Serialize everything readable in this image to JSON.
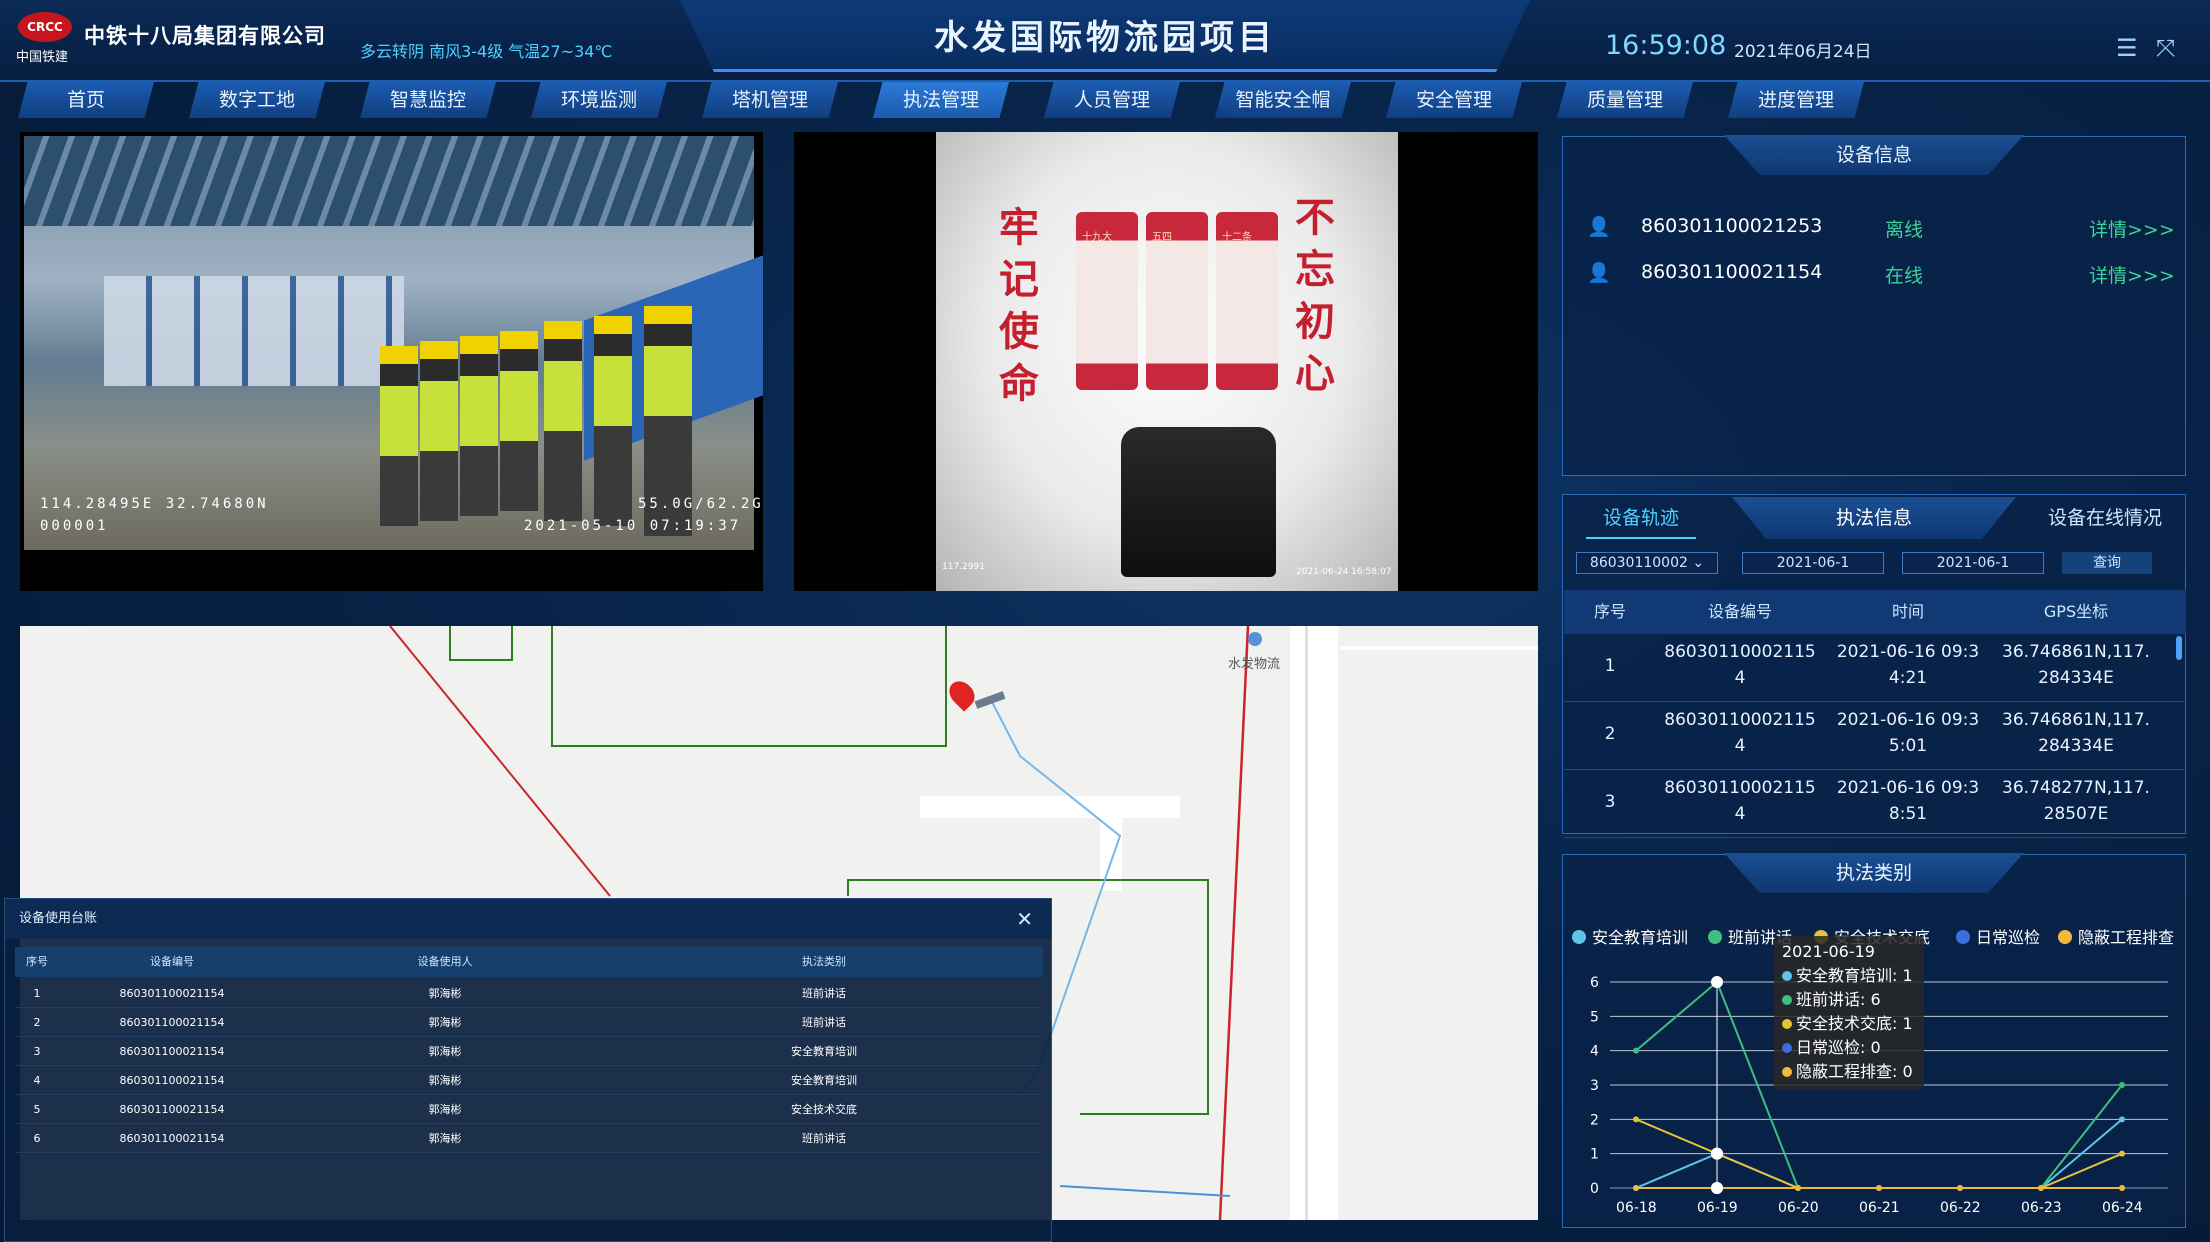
{
  "header": {
    "logo_text": "CRCC",
    "logo_sub": "中国铁建",
    "company": "中铁十八局集团有限公司",
    "weather": "多云转阴   南风3-4级   气温27~34℃",
    "title": "水发国际物流园项目",
    "time": "16:59:08",
    "date": "2021年06月24日",
    "menu_icon": "menu-list-icon",
    "fullscreen_icon": "fullscreen-icon"
  },
  "nav": [
    "首页",
    "数字工地",
    "智慧监控",
    "环境监测",
    "塔机管理",
    "执法管理",
    "人员管理",
    "智能安全帽",
    "安全管理",
    "质量管理",
    "进度管理"
  ],
  "nav_active": "执法管理",
  "video1": {
    "coords": "114.28495E 32.74680N",
    "id": "000001",
    "storage": "55.0G/62.2G",
    "timestamp": "2021-05-10  07:19:37"
  },
  "video2": {
    "slogan_left": "牢记使命",
    "slogan_right": "不忘初心",
    "panel_labels": [
      "十九大",
      "五四",
      "十二条"
    ],
    "tiny_left": "117.2991",
    "tiny_right": "2021-06-24 16:58:07"
  },
  "map": {
    "poi": "水发物流"
  },
  "device_info": {
    "title": "设备信息",
    "rows": [
      {
        "id": "860301100021253",
        "status": "离线",
        "status_color": "#3dd29a",
        "link": "详情>>>"
      },
      {
        "id": "860301100021154",
        "status": "在线",
        "status_color": "#3dd29a",
        "link": "详情>>>"
      }
    ]
  },
  "track": {
    "tabs": [
      "设备轨迹",
      "执法信息",
      "设备在线情况"
    ],
    "device_select": "86030110002",
    "date_from": "2021-06-1",
    "date_to": "2021-06-1",
    "query_label": "查询",
    "columns": [
      "序号",
      "设备编号",
      "时间",
      "GPS坐标"
    ],
    "rows": [
      {
        "no": "1",
        "dev1": "86030110002115",
        "dev2": "4",
        "t1": "2021-06-16 09:3",
        "t2": "4:21",
        "g1": "36.746861N,117.",
        "g2": "284334E"
      },
      {
        "no": "2",
        "dev1": "86030110002115",
        "dev2": "4",
        "t1": "2021-06-16 09:3",
        "t2": "5:01",
        "g1": "36.746861N,117.",
        "g2": "284334E"
      },
      {
        "no": "3",
        "dev1": "86030110002115",
        "dev2": "4",
        "t1": "2021-06-16 09:3",
        "t2": "8:51",
        "g1": "36.748277N,117.",
        "g2": "28507E"
      }
    ]
  },
  "enforcement_type": {
    "title": "执法类别",
    "tooltip": {
      "date": "2021-06-19",
      "lines": [
        "安全教育培训: 1",
        "班前讲话: 6",
        "安全技术交底: 1",
        "日常巡检: 0",
        "隐蔽工程排查: 0"
      ]
    }
  },
  "chart_data": {
    "type": "line",
    "categories": [
      "06-18",
      "06-19",
      "06-20",
      "06-21",
      "06-22",
      "06-23",
      "06-24"
    ],
    "ylim": [
      0,
      6
    ],
    "yticks": [
      "0",
      "1",
      "2",
      "3",
      "4",
      "5",
      "6"
    ],
    "legend_position": "top",
    "series": [
      {
        "name": "安全教育培训",
        "color": "#5fc3ea",
        "values": [
          0,
          1,
          0,
          0,
          0,
          0,
          2
        ]
      },
      {
        "name": "班前讲话",
        "color": "#3fbf7f",
        "values": [
          4,
          6,
          0,
          0,
          0,
          0,
          3
        ]
      },
      {
        "name": "安全技术交底",
        "color": "#e5c23a",
        "values": [
          2,
          1,
          0,
          0,
          0,
          0,
          1
        ]
      },
      {
        "name": "日常巡检",
        "color": "#3b6fe0",
        "values": [
          0,
          0,
          0,
          0,
          0,
          0,
          0
        ]
      },
      {
        "name": "隐蔽工程排查",
        "color": "#f0b93c",
        "values": [
          0,
          0,
          0,
          0,
          0,
          0,
          0
        ]
      }
    ]
  },
  "ledger": {
    "title": "设备使用台账",
    "close_icon": "close-icon",
    "columns": [
      "序号",
      "设备编号",
      "设备使用人",
      "执法类别"
    ],
    "rows": [
      {
        "no": "1",
        "id": "860301100021154",
        "user": "郭海彬",
        "type": "班前讲话"
      },
      {
        "no": "2",
        "id": "860301100021154",
        "user": "郭海彬",
        "type": "班前讲话"
      },
      {
        "no": "3",
        "id": "860301100021154",
        "user": "郭海彬",
        "type": "安全教育培训"
      },
      {
        "no": "4",
        "id": "860301100021154",
        "user": "郭海彬",
        "type": "安全教育培训"
      },
      {
        "no": "5",
        "id": "860301100021154",
        "user": "郭海彬",
        "type": "安全技术交底"
      },
      {
        "no": "6",
        "id": "860301100021154",
        "user": "郭海彬",
        "type": "班前讲话"
      }
    ]
  }
}
